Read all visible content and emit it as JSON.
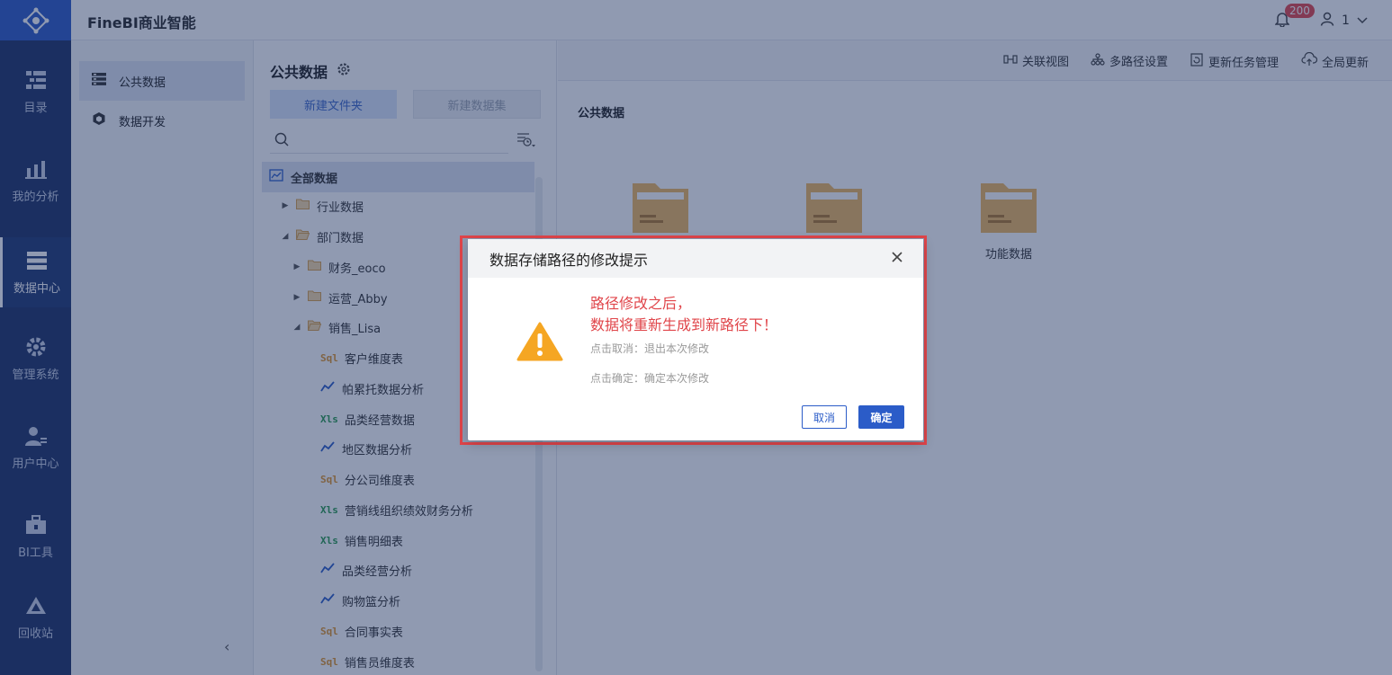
{
  "header": {
    "app_title": "FineBI商业智能",
    "notification_count": "200",
    "user_name": "1"
  },
  "rail": {
    "items": [
      {
        "label": "目录",
        "icon": "catalog-icon"
      },
      {
        "label": "我的分析",
        "icon": "analysis-icon"
      },
      {
        "label": "数据中心",
        "icon": "data-center-icon",
        "active": true
      },
      {
        "label": "管理系统",
        "icon": "gear-icon"
      },
      {
        "label": "用户中心",
        "icon": "user-icon"
      },
      {
        "label": "BI工具",
        "icon": "toolbox-icon"
      },
      {
        "label": "回收站",
        "icon": "recycle-icon"
      }
    ]
  },
  "subnav": {
    "items": [
      {
        "label": "公共数据",
        "active": true
      },
      {
        "label": "数据开发"
      }
    ]
  },
  "tree_panel": {
    "title": "公共数据",
    "new_folder": "新建文件夹",
    "new_dataset": "新建数据集",
    "search_placeholder": "",
    "rows": [
      {
        "label": "全部数据"
      },
      {
        "label": "行业数据"
      },
      {
        "label": "部门数据"
      },
      {
        "label": "财务_eoco"
      },
      {
        "label": "运营_Abby"
      },
      {
        "label": "销售_Lisa"
      },
      {
        "label": "客户维度表",
        "tag": "Sql"
      },
      {
        "label": "帕累托数据分析",
        "tag": "chart"
      },
      {
        "label": "品类经营数据",
        "tag": "Xls"
      },
      {
        "label": "地区数据分析",
        "tag": "chart"
      },
      {
        "label": "分公司维度表",
        "tag": "Sql"
      },
      {
        "label": "营销线组织绩效财务分析",
        "tag": "Xls"
      },
      {
        "label": "销售明细表",
        "tag": "Xls"
      },
      {
        "label": "品类经营分析",
        "tag": "chart"
      },
      {
        "label": "购物篮分析",
        "tag": "chart"
      },
      {
        "label": "合同事实表",
        "tag": "Sql"
      },
      {
        "label": "销售员维度表",
        "tag": "Sql"
      }
    ]
  },
  "toolbar": {
    "relation_view": "关联视图",
    "multi_path": "多路径设置",
    "update_tasks": "更新任务管理",
    "global_update": "全局更新"
  },
  "content": {
    "breadcrumb": "公共数据",
    "folders": [
      "",
      "",
      "功能数据"
    ]
  },
  "dialog": {
    "title": "数据存储路径的修改提示",
    "line1": "路径修改之后，",
    "line2": "数据将重新生成到新路径下！",
    "hint_cancel": "点击取消：退出本次修改",
    "hint_ok": "点击确定：确定本次修改",
    "cancel": "取消",
    "ok": "确定"
  }
}
